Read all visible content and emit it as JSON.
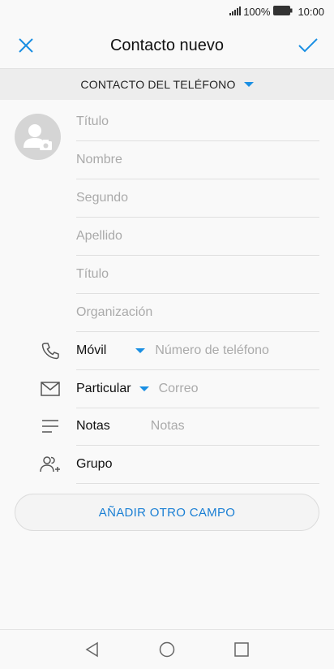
{
  "status": {
    "battery_pct": "100%",
    "time": "10:00"
  },
  "header": {
    "title": "Contacto nuevo"
  },
  "account": {
    "label": "CONTACTO DEL TELÉFONO"
  },
  "name_fields": [
    {
      "placeholder": "Título"
    },
    {
      "placeholder": "Nombre"
    },
    {
      "placeholder": "Segundo"
    },
    {
      "placeholder": "Apellido"
    },
    {
      "placeholder": "Título"
    },
    {
      "placeholder": "Organización"
    }
  ],
  "phone": {
    "type": "Móvil",
    "placeholder": "Número de teléfono"
  },
  "email": {
    "type": "Particular",
    "placeholder": "Correo"
  },
  "notes": {
    "label": "Notas",
    "placeholder": "Notas"
  },
  "group": {
    "label": "Grupo"
  },
  "add_field_button": {
    "label": "AÑADIR OTRO CAMPO"
  },
  "colors": {
    "accent": "#1a8fe3",
    "placeholder": "#aaaaaa",
    "background": "#f9f9f9"
  }
}
